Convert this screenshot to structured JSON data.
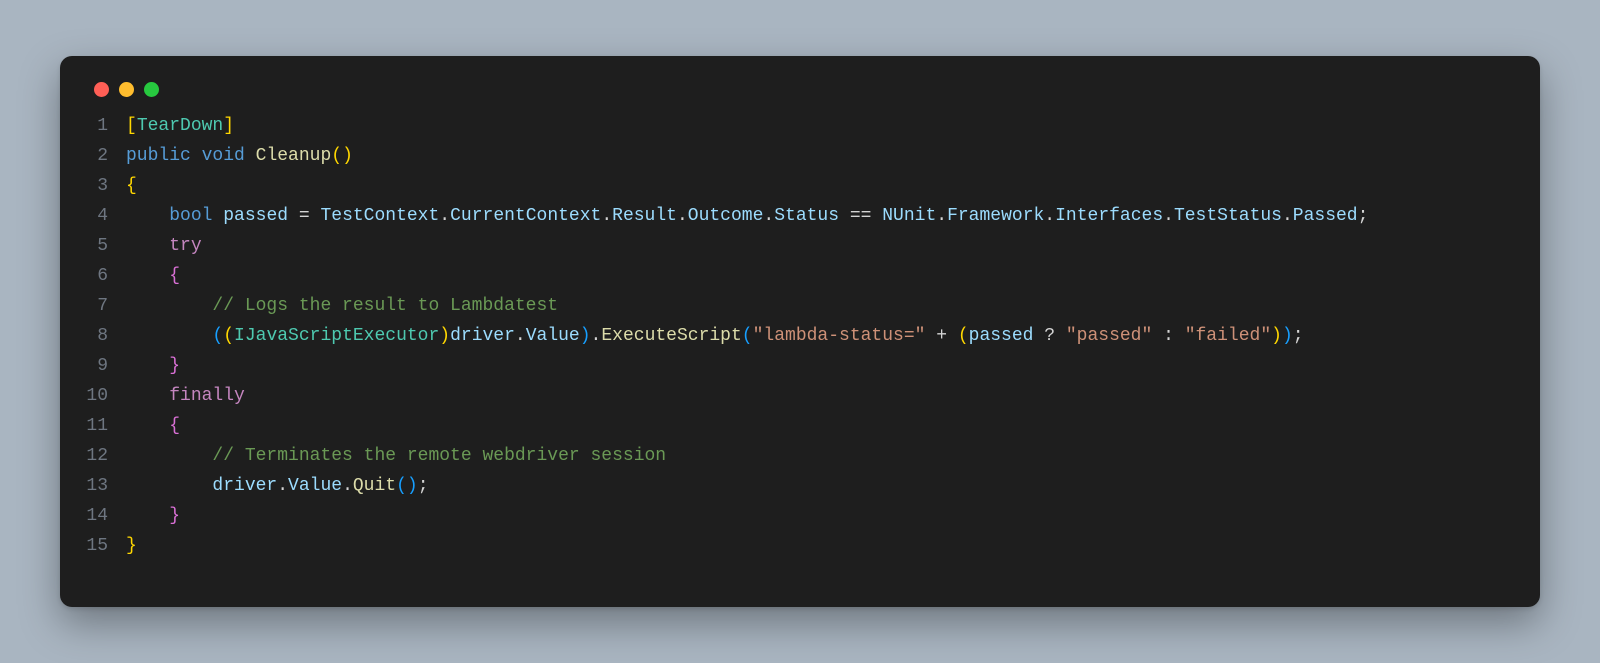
{
  "window": {
    "traffic_lights": [
      "close",
      "minimize",
      "zoom"
    ]
  },
  "code": {
    "lines": [
      {
        "n": "1",
        "tokens": [
          {
            "t": "[",
            "c": "br-gold"
          },
          {
            "t": "TearDown",
            "c": "type"
          },
          {
            "t": "]",
            "c": "br-gold"
          }
        ]
      },
      {
        "n": "2",
        "tokens": [
          {
            "t": "public",
            "c": "kw-blue"
          },
          {
            "t": " ",
            "c": "default"
          },
          {
            "t": "void",
            "c": "kw-blue"
          },
          {
            "t": " ",
            "c": "default"
          },
          {
            "t": "Cleanup",
            "c": "method"
          },
          {
            "t": "(",
            "c": "br-gold"
          },
          {
            "t": ")",
            "c": "br-gold"
          }
        ]
      },
      {
        "n": "3",
        "tokens": [
          {
            "t": "{",
            "c": "br-gold"
          }
        ]
      },
      {
        "n": "4",
        "tokens": [
          {
            "t": "    ",
            "c": "default"
          },
          {
            "t": "bool",
            "c": "kw-blue"
          },
          {
            "t": " ",
            "c": "default"
          },
          {
            "t": "passed",
            "c": "var"
          },
          {
            "t": " = ",
            "c": "default"
          },
          {
            "t": "TestContext",
            "c": "var"
          },
          {
            "t": ".",
            "c": "default"
          },
          {
            "t": "CurrentContext",
            "c": "var"
          },
          {
            "t": ".",
            "c": "default"
          },
          {
            "t": "Result",
            "c": "var"
          },
          {
            "t": ".",
            "c": "default"
          },
          {
            "t": "Outcome",
            "c": "var"
          },
          {
            "t": ".",
            "c": "default"
          },
          {
            "t": "Status",
            "c": "var"
          },
          {
            "t": " == ",
            "c": "default"
          },
          {
            "t": "NUnit",
            "c": "var"
          },
          {
            "t": ".",
            "c": "default"
          },
          {
            "t": "Framework",
            "c": "var"
          },
          {
            "t": ".",
            "c": "default"
          },
          {
            "t": "Interfaces",
            "c": "var"
          },
          {
            "t": ".",
            "c": "default"
          },
          {
            "t": "TestStatus",
            "c": "var"
          },
          {
            "t": ".",
            "c": "default"
          },
          {
            "t": "Passed",
            "c": "var"
          },
          {
            "t": ";",
            "c": "default"
          }
        ]
      },
      {
        "n": "5",
        "tokens": [
          {
            "t": "    ",
            "c": "default"
          },
          {
            "t": "try",
            "c": "kw-pink"
          }
        ]
      },
      {
        "n": "6",
        "tokens": [
          {
            "t": "    ",
            "c": "default"
          },
          {
            "t": "{",
            "c": "br-purp"
          }
        ]
      },
      {
        "n": "7",
        "tokens": [
          {
            "t": "        ",
            "c": "default"
          },
          {
            "t": "// Logs the result to Lambdatest",
            "c": "comment"
          }
        ]
      },
      {
        "n": "8",
        "tokens": [
          {
            "t": "        ",
            "c": "default"
          },
          {
            "t": "(",
            "c": "br-blue"
          },
          {
            "t": "(",
            "c": "br-gold"
          },
          {
            "t": "IJavaScriptExecutor",
            "c": "type"
          },
          {
            "t": ")",
            "c": "br-gold"
          },
          {
            "t": "driver",
            "c": "var"
          },
          {
            "t": ".",
            "c": "default"
          },
          {
            "t": "Value",
            "c": "var"
          },
          {
            "t": ")",
            "c": "br-blue"
          },
          {
            "t": ".",
            "c": "default"
          },
          {
            "t": "ExecuteScript",
            "c": "method"
          },
          {
            "t": "(",
            "c": "br-blue"
          },
          {
            "t": "\"lambda-status=\"",
            "c": "str"
          },
          {
            "t": " + ",
            "c": "default"
          },
          {
            "t": "(",
            "c": "br-gold"
          },
          {
            "t": "passed",
            "c": "var"
          },
          {
            "t": " ? ",
            "c": "default"
          },
          {
            "t": "\"passed\"",
            "c": "str"
          },
          {
            "t": " : ",
            "c": "default"
          },
          {
            "t": "\"failed\"",
            "c": "str"
          },
          {
            "t": ")",
            "c": "br-gold"
          },
          {
            "t": ")",
            "c": "br-blue"
          },
          {
            "t": ";",
            "c": "default"
          }
        ]
      },
      {
        "n": "9",
        "tokens": [
          {
            "t": "    ",
            "c": "default"
          },
          {
            "t": "}",
            "c": "br-purp"
          }
        ]
      },
      {
        "n": "10",
        "tokens": [
          {
            "t": "    ",
            "c": "default"
          },
          {
            "t": "finally",
            "c": "kw-pink"
          }
        ]
      },
      {
        "n": "11",
        "tokens": [
          {
            "t": "    ",
            "c": "default"
          },
          {
            "t": "{",
            "c": "br-purp"
          }
        ]
      },
      {
        "n": "12",
        "tokens": [
          {
            "t": "        ",
            "c": "default"
          },
          {
            "t": "// Terminates the remote webdriver session",
            "c": "comment"
          }
        ]
      },
      {
        "n": "13",
        "tokens": [
          {
            "t": "        ",
            "c": "default"
          },
          {
            "t": "driver",
            "c": "var"
          },
          {
            "t": ".",
            "c": "default"
          },
          {
            "t": "Value",
            "c": "var"
          },
          {
            "t": ".",
            "c": "default"
          },
          {
            "t": "Quit",
            "c": "method"
          },
          {
            "t": "(",
            "c": "br-blue"
          },
          {
            "t": ")",
            "c": "br-blue"
          },
          {
            "t": ";",
            "c": "default"
          }
        ]
      },
      {
        "n": "14",
        "tokens": [
          {
            "t": "    ",
            "c": "default"
          },
          {
            "t": "}",
            "c": "br-purp"
          }
        ]
      },
      {
        "n": "15",
        "tokens": [
          {
            "t": "}",
            "c": "br-gold"
          }
        ]
      }
    ]
  }
}
